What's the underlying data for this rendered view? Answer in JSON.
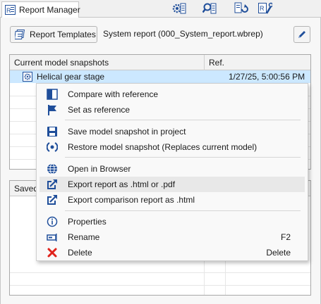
{
  "tab": {
    "title": "Report Manager",
    "icon": "report-icon"
  },
  "toolbar": {
    "icons": [
      "gear-report-icon",
      "search-report-icon",
      "refresh-report-icon",
      "report-settings-icon"
    ]
  },
  "header": {
    "templates_button": "Report Templates",
    "report_name": "System report (000_System_report.wbrep)",
    "edit_icon": "pencil-icon"
  },
  "snapshots_table": {
    "columns": [
      "Current model snapshots",
      "Ref."
    ],
    "rows": [
      {
        "name": "Helical gear stage",
        "date": "1/27/25, 5:00:56 PM",
        "icon": "gear-stage-icon"
      }
    ]
  },
  "saved_table": {
    "columns": [
      "Saved"
    ]
  },
  "context_menu": {
    "items": [
      {
        "label": "Compare with reference",
        "icon": "compare-icon"
      },
      {
        "label": "Set as reference",
        "icon": "flag-icon"
      },
      {
        "label": "Save model snapshot in project",
        "icon": "save-icon"
      },
      {
        "label": "Restore model snapshot (Replaces current model)",
        "icon": "restore-icon"
      },
      {
        "label": "Open in Browser",
        "icon": "globe-icon"
      },
      {
        "label": "Export report as .html or .pdf",
        "icon": "export-icon"
      },
      {
        "label": "Export comparison report as .html",
        "icon": "export-icon"
      },
      {
        "label": "Properties",
        "icon": "info-icon"
      },
      {
        "label": "Rename",
        "icon": "rename-icon",
        "shortcut": "F2"
      },
      {
        "label": "Delete",
        "icon": "delete-icon",
        "shortcut": "Delete"
      }
    ]
  },
  "colors": {
    "selection": "#cce8ff",
    "accent": "#1f4e9a",
    "delete": "#e0221b"
  }
}
